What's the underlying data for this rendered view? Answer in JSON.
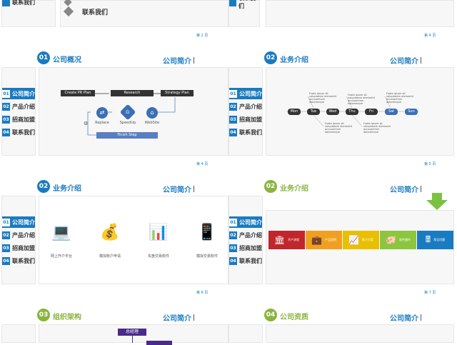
{
  "top": {
    "left_sidebar_item": "联系我们",
    "mid_menu_item": "联系我们",
    "right_sidebar_item": "联系我们",
    "page_left": "第 2 页",
    "page_right": "第 4 页"
  },
  "sidebar_items": [
    {
      "num": "01",
      "label": "公司简介"
    },
    {
      "num": "02",
      "label": "产品介绍"
    },
    {
      "num": "03",
      "label": "招商加盟"
    },
    {
      "num": "04",
      "label": "联系我们"
    }
  ],
  "company_label": "公司简介",
  "slide1": {
    "num": "01",
    "title": "公司概况",
    "flow": [
      "Create PR Plan",
      "Research",
      "Strategy Plan"
    ],
    "icons": [
      {
        "label": "Replace",
        "icon": "shuffle-icon"
      },
      {
        "label": "SpeedUp",
        "icon": "home-icon"
      },
      {
        "label": "WebSite",
        "icon": "home-icon"
      }
    ],
    "finish": "Finish Step",
    "page": "第 4 页"
  },
  "slide2": {
    "num": "02",
    "title": "业务介绍",
    "days": [
      "Mon",
      "Tue",
      "Wed",
      "Thu",
      "Fri",
      "Sat",
      "Sun"
    ],
    "note": "Fuata ipsum sit voluptatem elementit accusantium doloremque",
    "page": "第 5 页"
  },
  "slide3": {
    "num": "02",
    "title": "业务介绍",
    "items": [
      {
        "label": "网上开户平台",
        "icon": "laptop-chart-icon"
      },
      {
        "label": "模拟账户申请",
        "icon": "money-bag-icon"
      },
      {
        "label": "实盘交易软件",
        "icon": "bar-chart-icon"
      },
      {
        "label": "模拟交易软件",
        "icon": "phone-chart-icon"
      }
    ],
    "page": "第 6 页"
  },
  "slide4": {
    "num": "02",
    "title": "业务介绍",
    "tiles": [
      {
        "label": "开户流程",
        "color": "#c0262c",
        "icon": "bank-icon"
      },
      {
        "label": "产品说明",
        "color": "#f0a020",
        "icon": "briefcase-icon"
      },
      {
        "label": "推介方案",
        "color": "#e8c000",
        "icon": "chart-icon"
      },
      {
        "label": "软件操作",
        "color": "#8cc63f",
        "icon": "piggy-icon"
      },
      {
        "label": "常见问题",
        "color": "#1a7bc0",
        "icon": "calculator-icon"
      }
    ],
    "page": "第 7 页"
  },
  "slide5": {
    "num": "03",
    "title": "组织架构",
    "box": "总经理"
  },
  "slide6": {
    "num": "04",
    "title": "公司资质"
  },
  "colors": {
    "blue": "#1a7bc0",
    "green": "#8ab43f",
    "orange": "#f5a623"
  }
}
